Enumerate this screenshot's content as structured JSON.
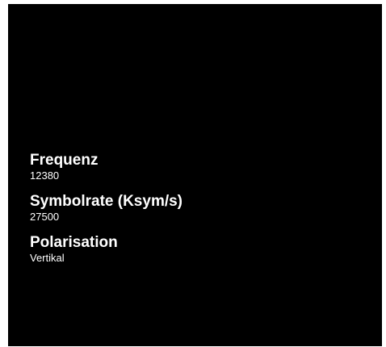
{
  "settings": {
    "items": [
      {
        "label": "Frequenz",
        "value": "12380"
      },
      {
        "label": "Symbolrate (Ksym/s)",
        "value": "27500"
      },
      {
        "label": "Polarisation",
        "value": "Vertikal"
      }
    ]
  },
  "colors": {
    "background": "#000000",
    "text": "#ffffff"
  }
}
